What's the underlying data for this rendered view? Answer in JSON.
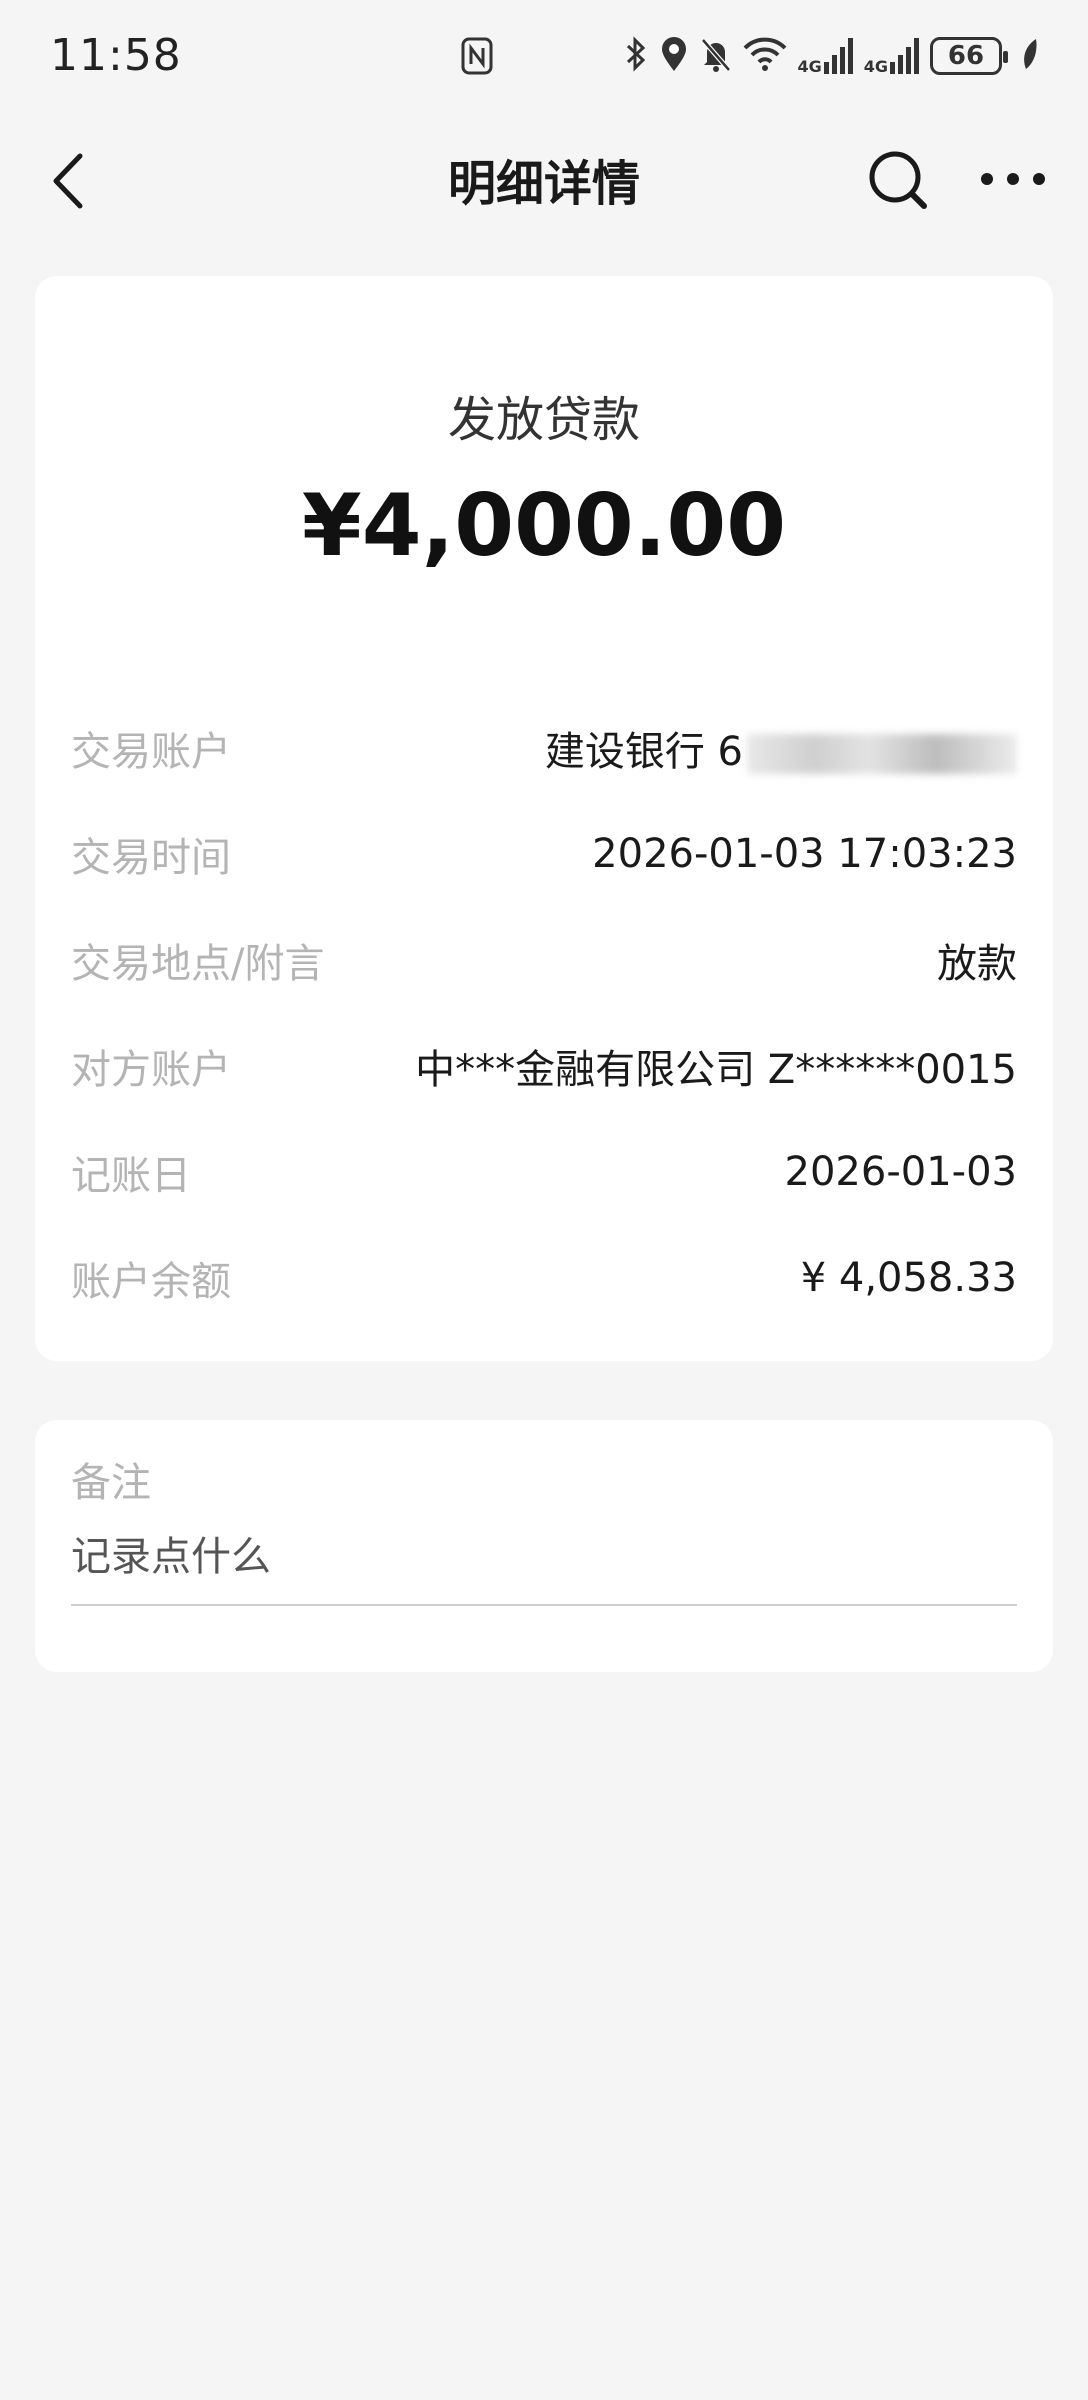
{
  "status_bar": {
    "time": "11:58",
    "battery": "66",
    "network_1": "4G",
    "network_2": "4G",
    "icons": [
      "nfc-icon",
      "bluetooth-icon",
      "location-icon",
      "bell-off-icon",
      "wifi-icon",
      "signal-icon",
      "signal-icon",
      "battery-icon",
      "leaf-icon"
    ]
  },
  "nav": {
    "title": "明细详情",
    "back_icon": "chevron-left-icon",
    "search_icon": "search-icon",
    "more_icon": "more-horizontal-icon"
  },
  "transaction": {
    "type": "发放贷款",
    "amount": "¥4,000.00"
  },
  "details": [
    {
      "label": "交易账户",
      "value": "建设银行 6"
    },
    {
      "label": "交易时间",
      "value": "2026-01-03 17:03:23"
    },
    {
      "label": "交易地点/附言",
      "value": "放款"
    },
    {
      "label": "对方账户",
      "value": "中***金融有限公司 Z******0015"
    },
    {
      "label": "记账日",
      "value": "2026-01-03"
    },
    {
      "label": "账户余额",
      "value": "¥ 4,058.33"
    }
  ],
  "note": {
    "label": "备注",
    "placeholder": "记录点什么"
  },
  "colors": {
    "background": "#f5f5f5",
    "card": "#ffffff",
    "label": "#b4b4b4",
    "text": "#1a1a1a"
  }
}
